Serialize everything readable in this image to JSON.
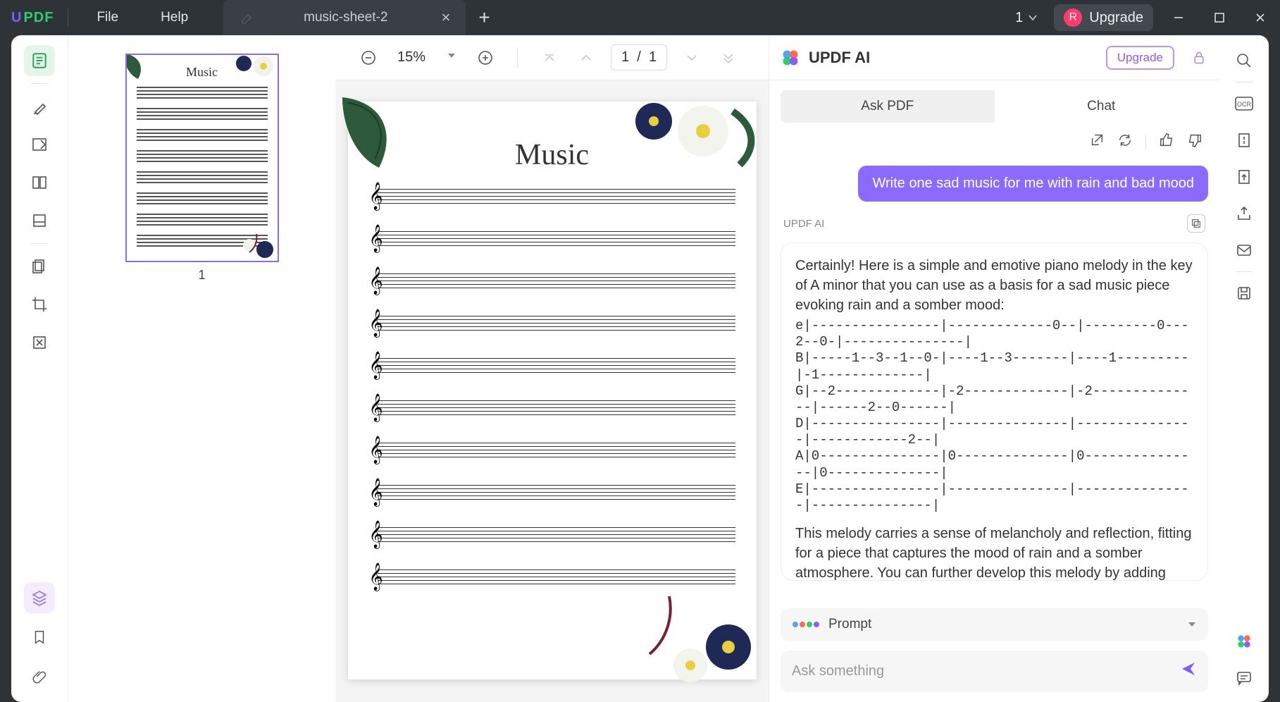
{
  "titlebar": {
    "logo_u": "U",
    "logo_pdf": "PDF",
    "menu": {
      "file": "File",
      "help": "Help"
    },
    "tab_title": "music-sheet-2",
    "file_count": "1",
    "upgrade": "Upgrade",
    "avatar_letter": "R"
  },
  "toolbar": {
    "zoom": "15%",
    "page_current": "1",
    "page_sep": "/",
    "page_total": "1"
  },
  "thumb": {
    "title": "Music",
    "page_num": "1"
  },
  "page": {
    "title": "Music"
  },
  "ai": {
    "title": "UPDF AI",
    "upgrade": "Upgrade",
    "tabs": {
      "ask": "Ask PDF",
      "chat": "Chat"
    },
    "label": "UPDF AI",
    "user_msg": "Write one sad music for me with rain and bad mood",
    "reply_intro": "Certainly! Here is a simple and emotive piano melody in the key of A minor that you can use as a basis for a sad music piece evoking rain and a somber mood:",
    "tab_e": "e|----------------|-------------0--|---------0---2--0-|---------------|",
    "tab_B": "B|-----1--3--1--0-|----1--3-------|----1---------|-1-------------|",
    "tab_G": "G|--2-------------|-2-------------|-2--------------|------2--0------|",
    "tab_D": "D|----------------|---------------|---------------|------------2--|",
    "tab_A": "A|0---------------|0--------------|0---------------|0--------------|",
    "tab_E": "E|----------------|---------------|---------------|---------------|",
    "reply_outro": "This melody carries a sense of melancholy and reflection, fitting for a piece that captures the mood of rain and a somber atmosphere. You can further develop this melody by adding harmonies, variations, dynamics, and additional layers to",
    "prompt_label": "Prompt",
    "ask_placeholder": "Ask something"
  }
}
